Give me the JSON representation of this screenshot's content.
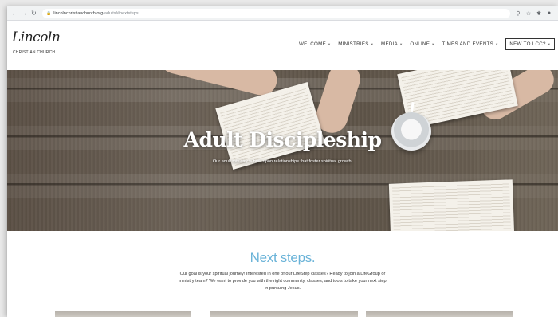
{
  "browser": {
    "url_host": "lincolnchristianchurch.org",
    "url_path": "/adults/#nextsteps",
    "icons": [
      "back-arrow-icon",
      "forward-arrow-icon",
      "reload-icon",
      "lock-icon",
      "search-icon",
      "star-icon",
      "extension-icon",
      "profile-icon"
    ]
  },
  "site": {
    "logo_script": "Lincoln",
    "logo_sub": "CHRISTIAN CHURCH"
  },
  "nav": {
    "items": [
      {
        "label": "WELCOME"
      },
      {
        "label": "MINISTRIES"
      },
      {
        "label": "MEDIA"
      },
      {
        "label": "ONLINE"
      },
      {
        "label": "TIMES AND EVENTS"
      }
    ],
    "cta": "NEW TO LCC?"
  },
  "hero": {
    "title": "Adult Discipleship",
    "subtitle": "Our adult ministry is built upon relationships that foster spiritual growth."
  },
  "next_steps": {
    "title": "Next steps.",
    "body": "Our goal is your spiritual journey! Interested in one of our LifeStep classes? Ready to join a LifeGroup or ministry team? We want to provide you with the right community, classes, and tools to take your next step in pursuing Jesus."
  },
  "colors": {
    "accent": "#6ab3d8",
    "text": "#333333"
  }
}
